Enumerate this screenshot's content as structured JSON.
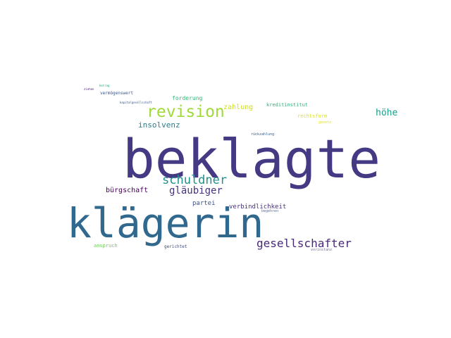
{
  "words": [
    {
      "text": "beklagte",
      "color": "#443983"
    },
    {
      "text": "klägerin",
      "color": "#31688e"
    },
    {
      "text": "revision",
      "color": "#a0da39"
    },
    {
      "text": "schuldner",
      "color": "#21918c"
    },
    {
      "text": "gesellschafter",
      "color": "#482878"
    },
    {
      "text": "gläubiger",
      "color": "#46327e"
    },
    {
      "text": "höhe",
      "color": "#1f9e89"
    },
    {
      "text": "insolvenz",
      "color": "#277f8e"
    },
    {
      "text": "bürgschaft",
      "color": "#440154"
    },
    {
      "text": "zahlung",
      "color": "#d0e11c"
    },
    {
      "text": "verbindlichkeit",
      "color": "#46307e"
    },
    {
      "text": "partei",
      "color": "#3b528b"
    },
    {
      "text": "forderung",
      "color": "#35b779"
    },
    {
      "text": "kreditinstitut",
      "color": "#2db27d"
    },
    {
      "text": "rechtsform",
      "color": "#dde318"
    },
    {
      "text": "anspruch",
      "color": "#6ece58"
    },
    {
      "text": "gerichtet",
      "color": "#3e4989"
    },
    {
      "text": "vermögenswert",
      "color": "#39568c"
    },
    {
      "text": "rückzahlung",
      "color": "#365c8d"
    },
    {
      "text": "begehren",
      "color": "#5b6fa0"
    },
    {
      "text": "vorinstanz",
      "color": "#7a6a9a"
    },
    {
      "text": "gesetz",
      "color": "#e5e419"
    },
    {
      "text": "kapitalgesellschaft",
      "color": "#3a548c"
    },
    {
      "text": "betrag",
      "color": "#25ab82"
    },
    {
      "text": "ziehen",
      "color": "#482173"
    }
  ]
}
